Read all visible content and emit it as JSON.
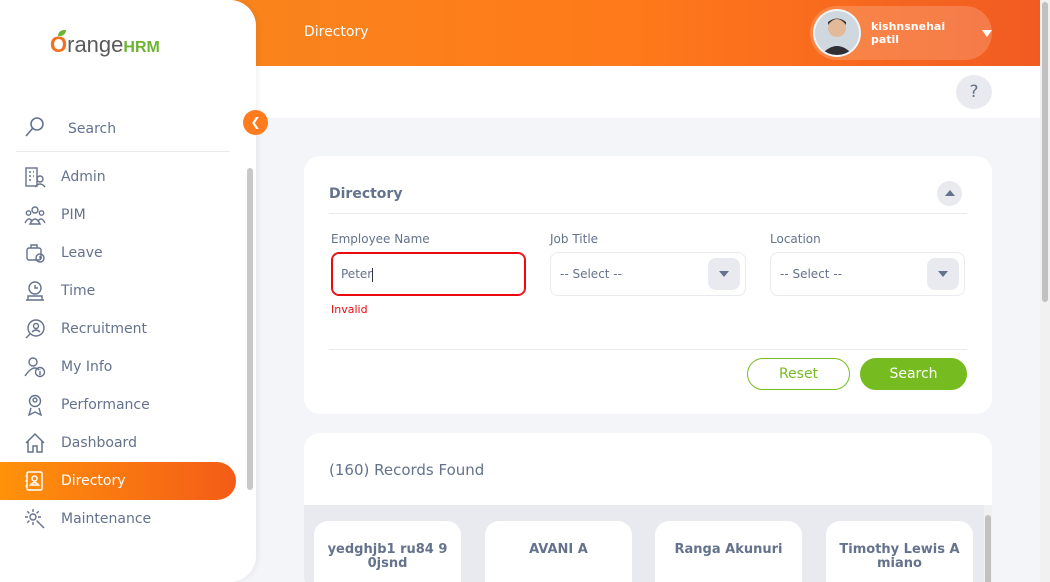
{
  "header": {
    "title": "Directory",
    "user_name": "kishnsnehai patil"
  },
  "brand": {
    "prefix": "O",
    "word": "range",
    "suffix": "HRM"
  },
  "sidebar": {
    "search_label": "Search",
    "items": [
      {
        "label": "Admin",
        "icon": "admin-icon"
      },
      {
        "label": "PIM",
        "icon": "pim-icon"
      },
      {
        "label": "Leave",
        "icon": "leave-icon"
      },
      {
        "label": "Time",
        "icon": "time-icon"
      },
      {
        "label": "Recruitment",
        "icon": "recruitment-icon"
      },
      {
        "label": "My Info",
        "icon": "my-info-icon"
      },
      {
        "label": "Performance",
        "icon": "performance-icon"
      },
      {
        "label": "Dashboard",
        "icon": "dashboard-icon"
      },
      {
        "label": "Directory",
        "icon": "directory-icon",
        "active": true
      },
      {
        "label": "Maintenance",
        "icon": "maintenance-icon"
      }
    ]
  },
  "filter": {
    "title": "Directory",
    "employee_name_label": "Employee Name",
    "employee_name_value": "Peter",
    "employee_name_error": "Invalid",
    "job_title_label": "Job Title",
    "job_title_value": "-- Select --",
    "location_label": "Location",
    "location_value": "-- Select --",
    "reset_label": "Reset",
    "search_label": "Search"
  },
  "results": {
    "count_text": "(160) Records Found",
    "employees": [
      {
        "name": "yedghjb1 ru84 9 0jsnd"
      },
      {
        "name": "AVANI A"
      },
      {
        "name": "Ranga Akunuri"
      },
      {
        "name": "Timothy Lewis A miano"
      }
    ]
  },
  "help_label": "?",
  "colors": {
    "accent": "#ff7b1d",
    "green": "#76bc21",
    "error": "#eb0910",
    "text": "#64728c"
  }
}
